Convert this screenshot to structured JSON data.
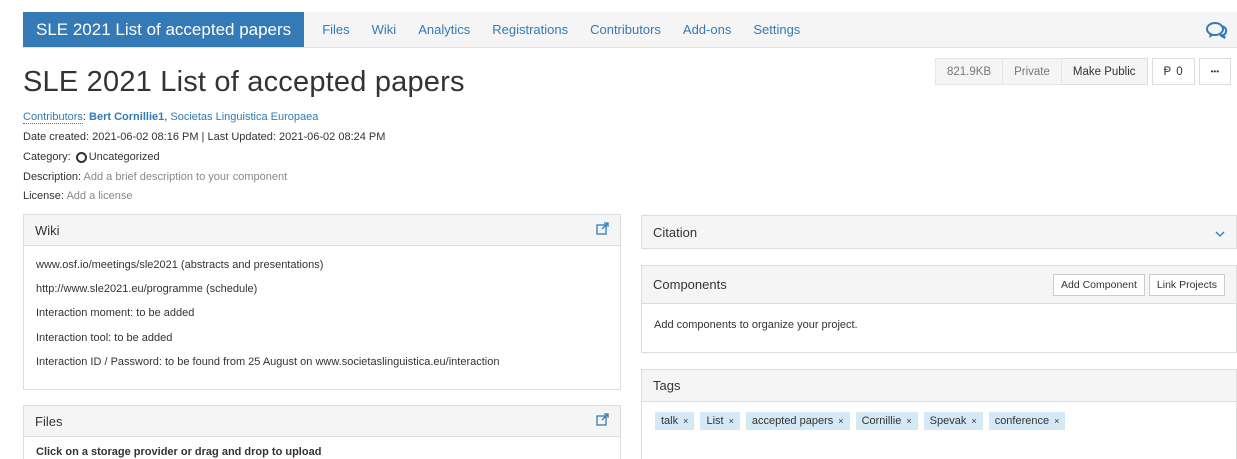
{
  "nav": {
    "title": "SLE 2021 List of accepted papers",
    "links": [
      "Files",
      "Wiki",
      "Analytics",
      "Registrations",
      "Contributors",
      "Add-ons",
      "Settings"
    ]
  },
  "header": {
    "title": "SLE 2021 List of accepted papers",
    "size": "821.9KB",
    "privacy": "Private",
    "make_public": "Make Public",
    "fork_symbol": "Ᵽ",
    "fork_count": "0",
    "more": "•••"
  },
  "meta": {
    "contributors_label": "Contributors",
    "contributor_1": "Bert Cornillie1",
    "contributor_2": "Societas Linguistica Europaea",
    "date_line": "Date created: 2021-06-02 08:16 PM | Last Updated: 2021-06-02 08:24 PM",
    "category_label": "Category:",
    "category_value": "Uncategorized",
    "description_label": "Description:",
    "description_value": "Add a brief description to your component",
    "license_label": "License:",
    "license_value": "Add a license"
  },
  "wiki": {
    "heading": "Wiki",
    "line1_link": "www.osf.io/meetings/sle2021",
    "line1_text": " (abstracts and presentations)",
    "line2_link": "http://www.sle2021.eu/programme",
    "line2_text": " (schedule)",
    "line3": "Interaction moment: to be added",
    "line4": "Interaction tool: to be added",
    "line5_text": "Interaction ID / Password: to be found from 25 August on ",
    "line5_link": "www.societaslinguistica.eu/interaction"
  },
  "files": {
    "heading": "Files",
    "hint": "Click on a storage provider or drag and drop to upload"
  },
  "citation": {
    "heading": "Citation"
  },
  "components": {
    "heading": "Components",
    "add_button": "Add Component",
    "link_button": "Link Projects",
    "empty_text": "Add components to organize your project."
  },
  "tags": {
    "heading": "Tags",
    "items": [
      "talk",
      "List",
      "accepted papers",
      "Cornillie",
      "Spevak",
      "conference"
    ],
    "remove_symbol": "×"
  },
  "colors": {
    "accent": "#337ab7",
    "tag_bg": "#d5e8f6"
  }
}
